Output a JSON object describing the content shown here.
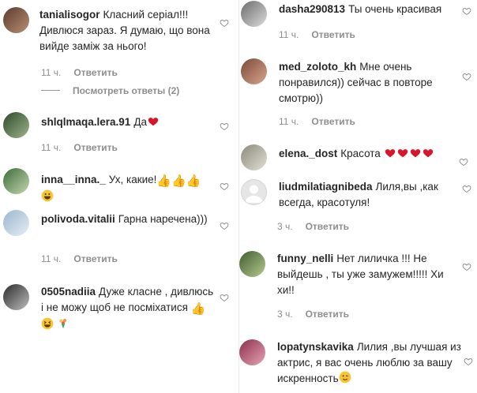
{
  "left": [
    {
      "user": "tanialisogor",
      "text": "Класний серіал!!! Дивлюся зараз. Я думаю, що вона вийде заміж за нього!",
      "time": "11 ч.",
      "reply": "Ответить",
      "view_replies": "Посмотреть ответы (2)"
    },
    {
      "user": "shlqlmaqa.lera.91",
      "text": "Да",
      "time": "11 ч.",
      "reply": "Ответить"
    },
    {
      "user": "inna__inna._",
      "text": "Ух, какие!",
      "time": "",
      "reply": ""
    },
    {
      "user": "polivoda.vitalii",
      "text": "Гарна наречена)))",
      "time": "11 ч.",
      "reply": "Ответить"
    },
    {
      "user": "0505nadiia",
      "text": "Дуже класне , дивлюсь і не можу щоб не посміхатися",
      "time": "",
      "reply": ""
    }
  ],
  "right": [
    {
      "user": "dasha290813",
      "text": "Ты очень красивая",
      "time": "11 ч.",
      "reply": "Ответить"
    },
    {
      "user": "med_zoloto_kh",
      "text": "Мне очень понравился)) сейчас в повторе смотрю))",
      "time": "11 ч.",
      "reply": "Ответить"
    },
    {
      "user": "elena._dost",
      "text": "Красота",
      "time": "",
      "reply": ""
    },
    {
      "user": "liudmilatiagnibeda",
      "text": "Лиля,вы ,как всегда, красотуля!",
      "time": "3 ч.",
      "reply": "Ответить"
    },
    {
      "user": "funny_nelli",
      "text": "Нет лиличка !!! Не выйдешь , ты уже замужем!!!!! Хи хи!!",
      "time": "3 ч.",
      "reply": "Ответить"
    },
    {
      "user": "lopatynskavika",
      "text": "Лилия ,вы лучшая из актрис, я вас очень люблю за вашу искренность",
      "time": "",
      "reply": ""
    }
  ],
  "colors": {
    "heart": "#ed4956",
    "thumb": "#f5b800",
    "secondary": "#8e8e8e"
  }
}
